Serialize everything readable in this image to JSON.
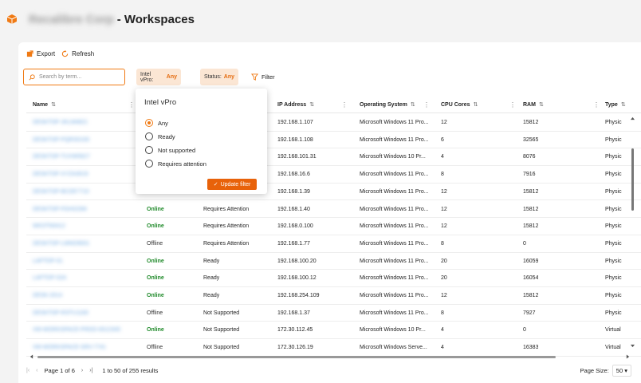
{
  "header": {
    "org_name": "Recalibre Corp",
    "title": "- Workspaces"
  },
  "toolbar": {
    "export_label": "Export",
    "refresh_label": "Refresh"
  },
  "search": {
    "placeholder": "Search by term..."
  },
  "filters": {
    "vpro_label": "Intel vPro:",
    "vpro_value": "Any",
    "status_label": "Status:",
    "status_value": "Any",
    "filter_label": "Filter"
  },
  "columns": [
    "Name",
    "",
    "",
    "IP Address",
    "Operating System",
    "CPU Cores",
    "RAM",
    "Type"
  ],
  "rows": [
    {
      "name": "DESKTOP-JKLM4821",
      "status": "",
      "vpro": "",
      "ip": "192.168.1.107",
      "os": "Microsoft Windows 11 Pro...",
      "cpu": "12",
      "ram": "15812",
      "type": "Physic"
    },
    {
      "name": "DESKTOP-PQRS0193",
      "status": "",
      "vpro": "",
      "ip": "192.168.1.108",
      "os": "Microsoft Windows 11 Pro...",
      "cpu": "6",
      "ram": "32565",
      "type": "Physic"
    },
    {
      "name": "DESKTOP-TUVW5627",
      "status": "",
      "vpro": "",
      "ip": "192.168.101.31",
      "os": "Microsoft Windows 10 Pr...",
      "cpu": "4",
      "ram": "8076",
      "type": "Physic"
    },
    {
      "name": "DESKTOP-XYZA3019",
      "status": "",
      "vpro": "",
      "ip": "192.168.16.6",
      "os": "Microsoft Windows 11 Pro...",
      "cpu": "8",
      "ram": "7916",
      "type": "Physic"
    },
    {
      "name": "DESKTOP-BCDE7710",
      "status": "",
      "vpro": "",
      "ip": "192.168.1.39",
      "os": "Microsoft Windows 11 Pro...",
      "cpu": "12",
      "ram": "15812",
      "type": "Physic"
    },
    {
      "name": "DESKTOP-FGHI2284",
      "status": "Online",
      "vpro": "Requires Attention",
      "ip": "192.168.1.40",
      "os": "Microsoft Windows 11 Pro...",
      "cpu": "12",
      "ram": "15812",
      "type": "Physic"
    },
    {
      "name": "WKSTN0412",
      "status": "Online",
      "vpro": "Requires Attention",
      "ip": "192.168.0.100",
      "os": "Microsoft Windows 11 Pro...",
      "cpu": "12",
      "ram": "15812",
      "type": "Physic"
    },
    {
      "name": "DESKTOP-LMNO9931",
      "status": "Offline",
      "vpro": "Requires Attention",
      "ip": "192.168.1.77",
      "os": "Microsoft Windows 11 Pro...",
      "cpu": "8",
      "ram": "0",
      "type": "Physic"
    },
    {
      "name": "LAPTOP-01",
      "status": "Online",
      "vpro": "Ready",
      "ip": "192.168.100.20",
      "os": "Microsoft Windows 11 Pro...",
      "cpu": "20",
      "ram": "16059",
      "type": "Physic"
    },
    {
      "name": "LAPTOP-02A",
      "status": "Online",
      "vpro": "Ready",
      "ip": "192.168.100.12",
      "os": "Microsoft Windows 11 Pro...",
      "cpu": "20",
      "ram": "16054",
      "type": "Physic"
    },
    {
      "name": "DESK-2014",
      "status": "Online",
      "vpro": "Ready",
      "ip": "192.168.254.109",
      "os": "Microsoft Windows 11 Pro...",
      "cpu": "12",
      "ram": "15812",
      "type": "Physic"
    },
    {
      "name": "DESKTOP-RSTU1183",
      "status": "Offline",
      "vpro": "Not Supported",
      "ip": "192.168.1.37",
      "os": "Microsoft Windows 11 Pro...",
      "cpu": "8",
      "ram": "7927",
      "type": "Physic"
    },
    {
      "name": "VM-WORKSPACE-PROD-0012345",
      "status": "Online",
      "vpro": "Not Supported",
      "ip": "172.30.112.45",
      "os": "Microsoft Windows 10 Pr...",
      "cpu": "4",
      "ram": "0",
      "type": "Virtual"
    },
    {
      "name": "VM-WORKSPACE-SRV-7741",
      "status": "Offline",
      "vpro": "Not Supported",
      "ip": "172.30.126.19",
      "os": "Microsoft Windows Serve...",
      "cpu": "4",
      "ram": "16383",
      "type": "Virtual"
    }
  ],
  "pager": {
    "page_label": "Page 1 of 6",
    "range_label": "1 to 50 of 255 results",
    "page_size_label": "Page Size:",
    "page_size_value": "50"
  },
  "popover": {
    "title": "Intel vPro",
    "options": [
      "Any",
      "Ready",
      "Not supported",
      "Requires attention"
    ],
    "selected_index": 0,
    "update_label": "Update filter"
  },
  "colors": {
    "accent": "#f07a14",
    "online": "#1f8a2a",
    "chip_bg": "#fbe6d4"
  }
}
